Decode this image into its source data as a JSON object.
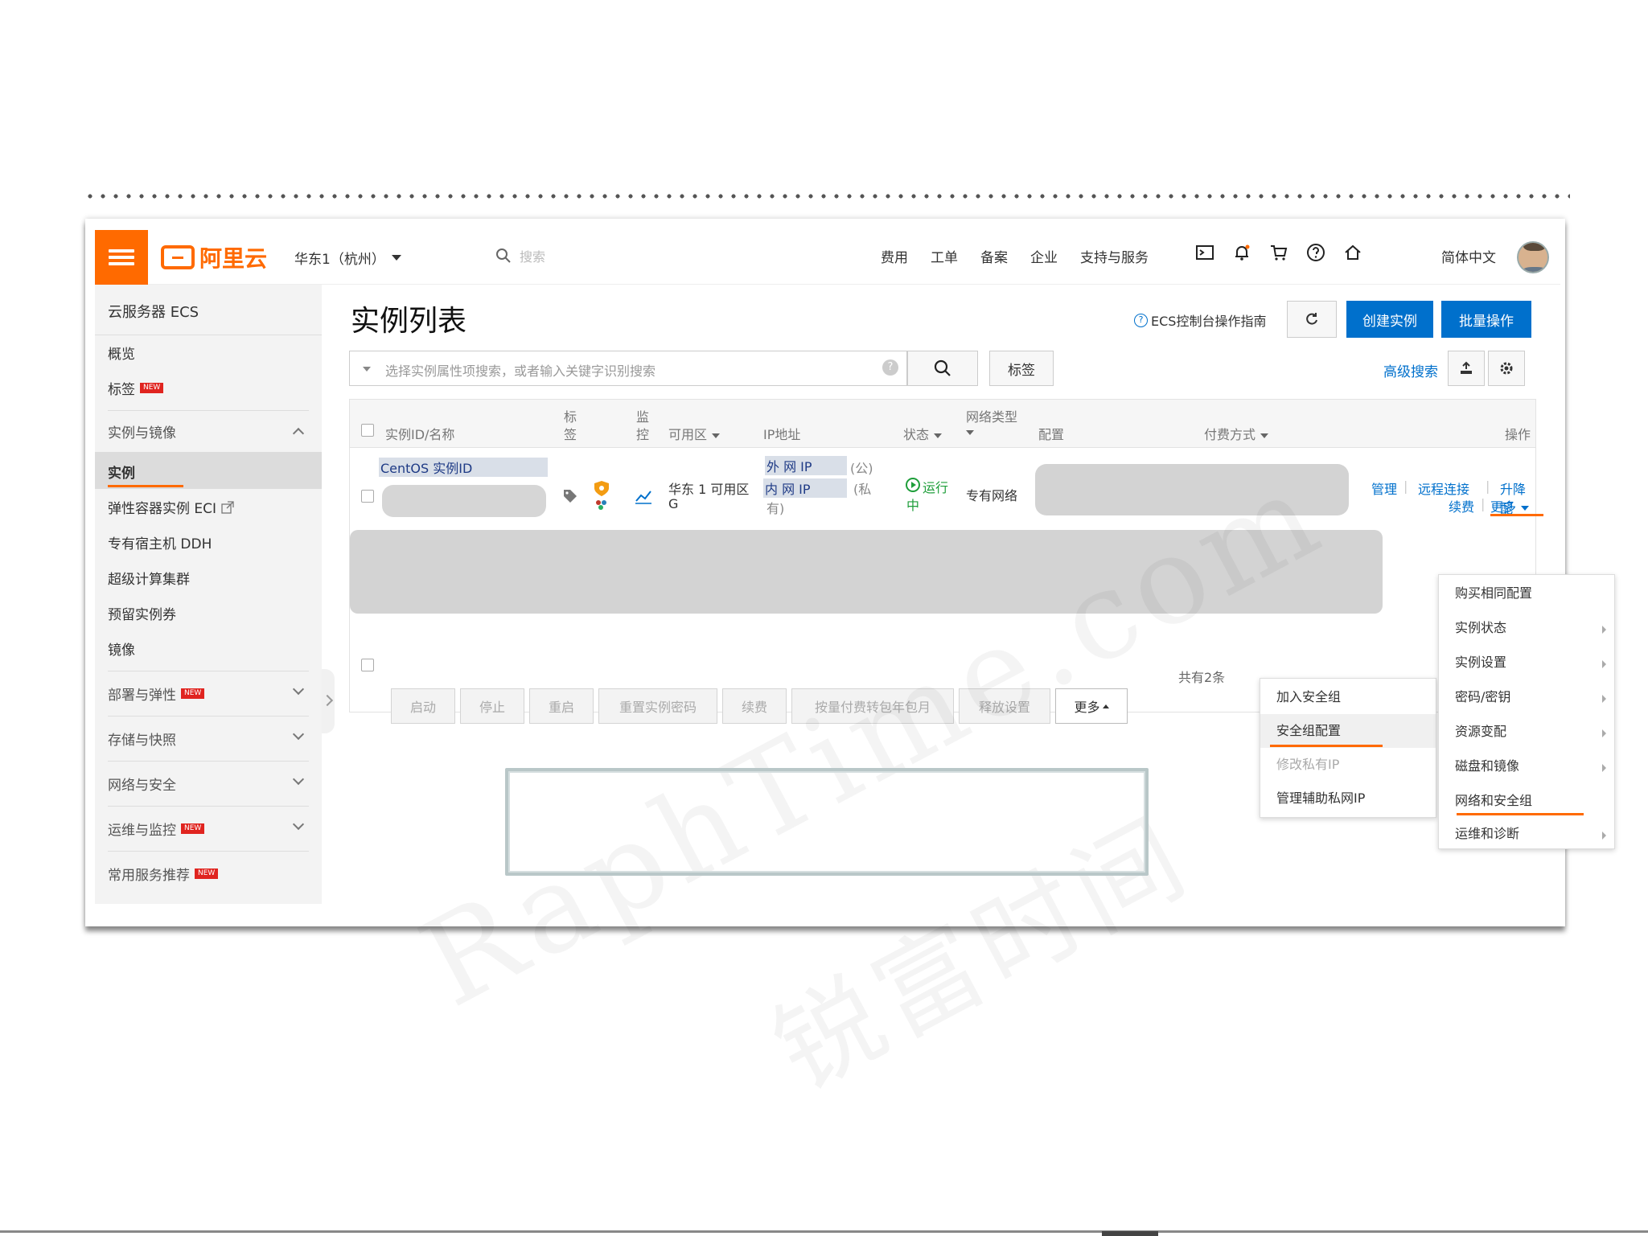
{
  "topbar": {
    "logo_text": "阿里云",
    "region": "华东1（杭州）",
    "search_placeholder": "搜索",
    "nav": [
      "费用",
      "工单",
      "备案",
      "企业",
      "支持与服务"
    ],
    "language": "简体中文"
  },
  "sidebar": {
    "title": "云服务器 ECS",
    "overview": "概览",
    "tags": "标签",
    "new_badge": "NEW",
    "section_instances": "实例与镜像",
    "items": [
      "实例",
      "弹性容器实例 ECI",
      "专有宿主机 DDH",
      "超级计算集群",
      "预留实例券",
      "镜像"
    ],
    "groups": [
      "部署与弹性",
      "存储与快照",
      "网络与安全",
      "运维与监控",
      "常用服务推荐"
    ]
  },
  "main": {
    "title": "实例列表",
    "guide": "ECS控制台操作指南",
    "create_button": "创建实例",
    "batch_button": "批量操作",
    "search_placeholder": "选择实例属性项搜索，或者输入关键字识别搜索",
    "tag_button": "标签",
    "advanced_search": "高级搜索"
  },
  "table": {
    "headers": {
      "id": "实例ID/名称",
      "tag_1": "标",
      "tag_2": "签",
      "monitor_1": "监",
      "monitor_2": "控",
      "zone": "可用区",
      "ip": "IP地址",
      "status": "状态",
      "network": "网络类型",
      "config": "配置",
      "billing": "付费方式",
      "actions": "操作"
    },
    "row": {
      "name": "CentOS 实例ID",
      "zone_line1": "华东 1 可用区",
      "zone_line2": "G",
      "public_ip": "外 网 IP",
      "public_suffix": "(公)",
      "private_ip": "内 网 IP",
      "private_suffix": "(私",
      "private_suffix2": "有)",
      "status_line1": "运行",
      "status_line2": "中",
      "network": "专有网络",
      "actions": [
        "管理",
        "远程连接",
        "升降配",
        "续费",
        "更多"
      ]
    },
    "footer_count": "共有2条"
  },
  "bulk_actions": [
    "启动",
    "停止",
    "重启",
    "重置实例密码",
    "续费",
    "按量付费转包年包月",
    "释放设置",
    "更多"
  ],
  "more_menu": [
    "购买相同配置",
    "实例状态",
    "实例设置",
    "密码/密钥",
    "资源变配",
    "磁盘和镜像",
    "网络和安全组",
    "运维和诊断"
  ],
  "network_submenu": [
    "加入安全组",
    "安全组配置",
    "修改私有IP",
    "管理辅助私网IP"
  ],
  "watermark": {
    "latin": "RaphTime.com",
    "cjk": "锐富时间"
  },
  "colors": {
    "brand_orange": "#ff6a00",
    "primary_blue": "#0070cc",
    "running_green": "#1e9e3a"
  }
}
